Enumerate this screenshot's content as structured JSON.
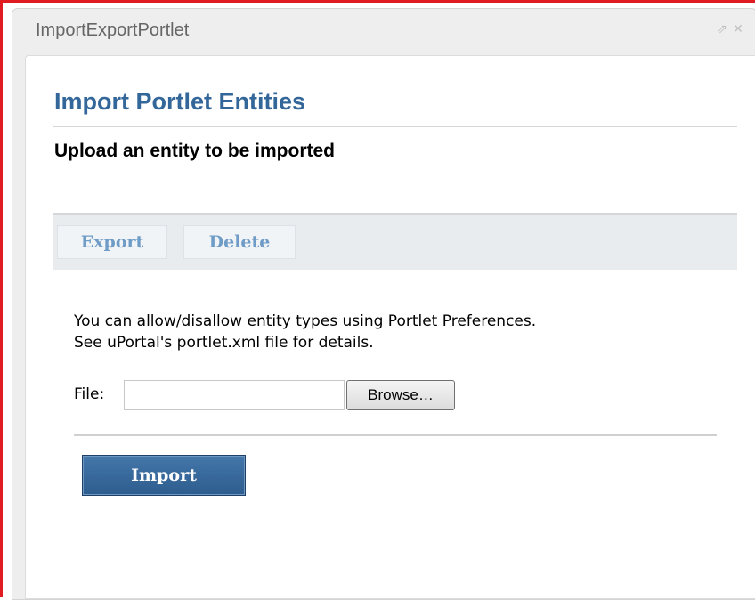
{
  "portlet": {
    "title": "ImportExportPortlet",
    "controls": [
      {
        "name": "maximize-icon",
        "glyph": "⇗"
      },
      {
        "name": "close-icon",
        "glyph": "✕"
      }
    ]
  },
  "main": {
    "heading": "Import Portlet Entities",
    "subheading": "Upload an entity to be imported",
    "toolbar": {
      "export_label": "Export",
      "delete_label": "Delete"
    },
    "info": {
      "line1": "You can allow/disallow entity types using Portlet Preferences.",
      "line2": "See uPortal's portlet.xml file for details."
    },
    "form": {
      "file_label": "File:",
      "file_value": "",
      "browse_label": "Browse…",
      "import_label": "Import"
    }
  },
  "colors": {
    "frame_border": "#e11b22",
    "heading": "#336699",
    "toolbar_bg": "#e8ecef",
    "toolbar_button_text": "#6f9cc7",
    "import_button": "#2e5c8e"
  }
}
